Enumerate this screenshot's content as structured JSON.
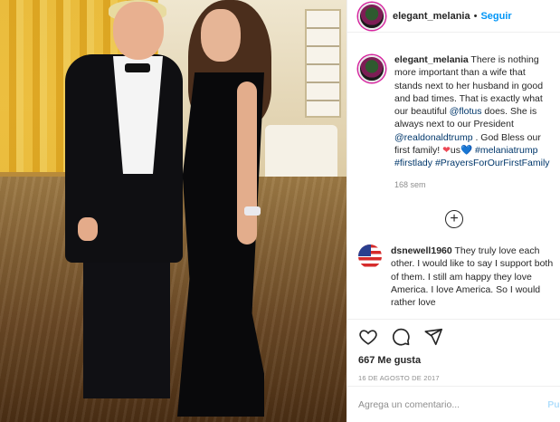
{
  "header": {
    "username": "elegant_melania",
    "separator": "•",
    "follow_label": "Seguir"
  },
  "caption": {
    "username": "elegant_melania",
    "text_1": " There is nothing more important than a wife that stands next to her husband in good and bad times. That is exactly what our beautiful ",
    "mention_flotus": "@flotus",
    "text_2": " does. She is always next to our President ",
    "mention_trump": "@realdonaldtrump",
    "text_3": " . God Bless our first family! ",
    "heart_red": "❤",
    "text_us": "us",
    "heart_blue": "💙",
    "text_4": " ",
    "hashtag_1": "#melaniatrump",
    "hashtag_2": "#firstlady",
    "hashtag_3": "#PrayersForOurFirstFamily",
    "time": "168 sem"
  },
  "load_more_glyph": "+",
  "comment": {
    "username": "dsnewell1960",
    "text": " They truly love each other. I would like to say I support both of them. I still am happy they love America. I love America. So I would rather love"
  },
  "actions": {
    "icons": [
      "heart-icon",
      "comment-icon",
      "share-icon"
    ],
    "likes": "667 Me gusta",
    "date": "16 DE AGOSTO DE 2017"
  },
  "add_comment": {
    "placeholder": "Agrega un comentario...",
    "publish_label": "Publ"
  },
  "colors": {
    "link": "#00376b",
    "follow": "#0095f6",
    "heart": "#ed4956",
    "publish": "#b2dffc"
  }
}
